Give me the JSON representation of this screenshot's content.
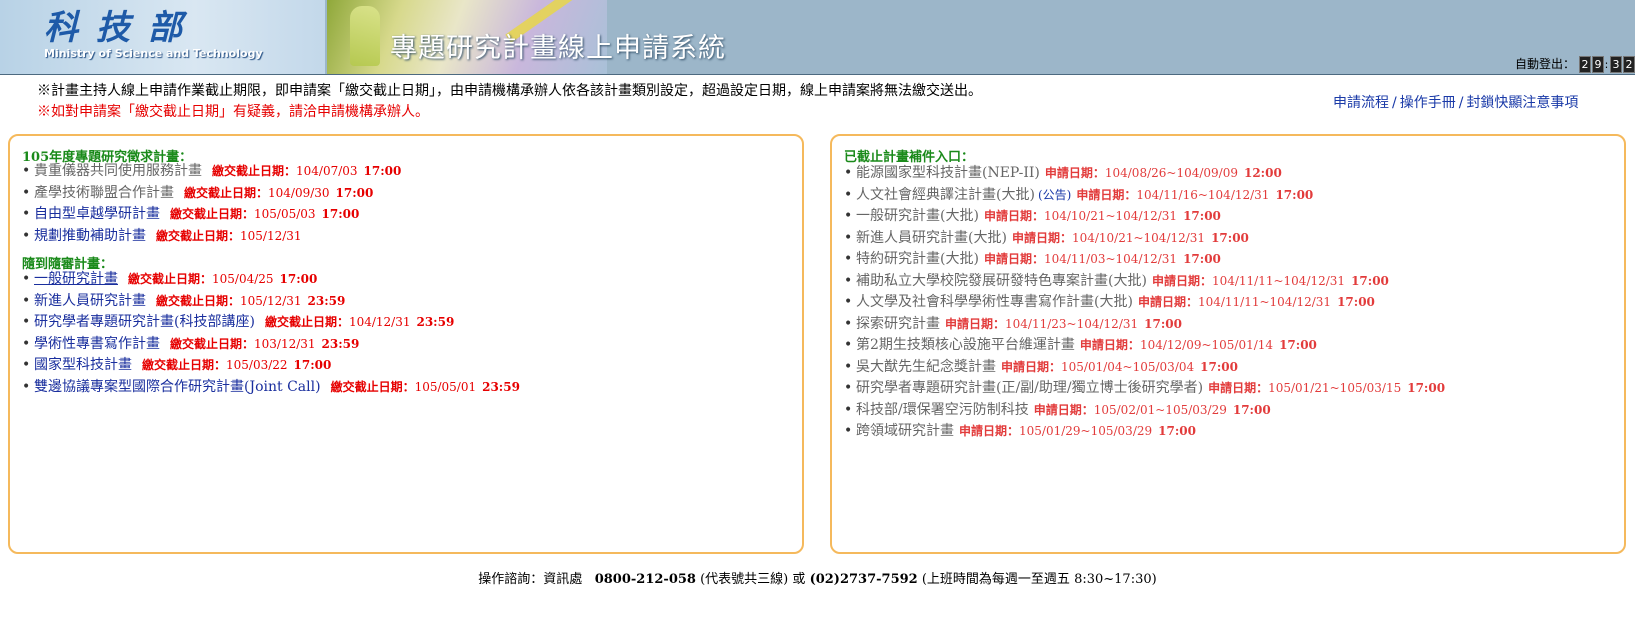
{
  "header": {
    "logo_mark": "科技部",
    "logo_en": "Ministry of Science and Technology",
    "system_title": "專題研究計畫線上申請系統",
    "logout_label": "自動登出：",
    "timer_digits": [
      "2",
      "9",
      "3",
      "2"
    ]
  },
  "notices": {
    "line1": "※計畫主持人線上申請作業截止期限，即申請案「繳交截止日期」，由申請機構承辦人依各該計畫類別設定，超過設定日期，線上申請案將無法繳交送出。",
    "line2": "※如對申請案「繳交截止日期」有疑義，請洽申請機構承辦人。"
  },
  "top_links": [
    "申請流程",
    "操作手冊",
    "封鎖快顯注意事項"
  ],
  "left_panel": {
    "section1_title": "105年度專題研究徵求計畫：",
    "deadline_label": "繳交截止日期：",
    "section1_items": [
      {
        "name": "貴重儀器共同使用服務計畫",
        "date": "104/07/03",
        "time": "17:00",
        "style": "gray"
      },
      {
        "name": "產學技術聯盟合作計畫",
        "date": "104/09/30",
        "time": "17:00",
        "style": "gray"
      },
      {
        "name": "自由型卓越學研計畫",
        "date": "105/05/03",
        "time": "17:00",
        "style": "blue"
      },
      {
        "name": "規劃推動補助計畫",
        "date": "105/12/31",
        "time": "",
        "style": "blue"
      }
    ],
    "section2_title": "隨到隨審計畫：",
    "section2_items": [
      {
        "name": "一般研究計畫",
        "date": "105/04/25",
        "time": "17:00",
        "style": "blue-ul"
      },
      {
        "name": "新進人員研究計畫",
        "date": "105/12/31",
        "time": "23:59",
        "style": "blue"
      },
      {
        "name": "研究學者專題研究計畫(科技部講座)",
        "date": "104/12/31",
        "time": "23:59",
        "style": "blue"
      },
      {
        "name": "學術性專書寫作計畫",
        "date": "103/12/31",
        "time": "23:59",
        "style": "blue"
      },
      {
        "name": "國家型科技計畫",
        "date": "105/03/22",
        "time": "17:00",
        "style": "blue"
      },
      {
        "name": "雙邊協議專案型國際合作研究計畫(Joint Call)",
        "date": "105/05/01",
        "time": "23:59",
        "style": "blue"
      }
    ]
  },
  "right_panel": {
    "section_title": "已截止計畫補件入口：",
    "apply_label": "申請日期：",
    "notice_link": "(公告)",
    "items": [
      {
        "name": "能源國家型科技計畫(NEP-II)",
        "range": "104/08/26~104/09/09",
        "time": "12:00"
      },
      {
        "name": "人文社會經典譯注計畫(大批)",
        "range": "104/11/16~104/12/31",
        "time": "17:00",
        "has_notice": true
      },
      {
        "name": "一般研究計畫(大批)",
        "range": "104/10/21~104/12/31",
        "time": "17:00"
      },
      {
        "name": "新進人員研究計畫(大批)",
        "range": "104/10/21~104/12/31",
        "time": "17:00"
      },
      {
        "name": "特約研究計畫(大批)",
        "range": "104/11/03~104/12/31",
        "time": "17:00"
      },
      {
        "name": "補助私立大學校院發展研發特色專案計畫(大批)",
        "range": "104/11/11~104/12/31",
        "time": "17:00"
      },
      {
        "name": "人文學及社會科學學術性專書寫作計畫(大批)",
        "range": "104/11/11~104/12/31",
        "time": "17:00"
      },
      {
        "name": "探索研究計畫",
        "range": "104/11/23~104/12/31",
        "time": "17:00"
      },
      {
        "name": "第2期生技類核心設施平台維運計畫",
        "range": "104/12/09~105/01/14",
        "time": "17:00"
      },
      {
        "name": "吳大猷先生紀念獎計畫",
        "range": "105/01/04~105/03/04",
        "time": "17:00"
      },
      {
        "name": "研究學者專題研究計畫(正/副/助理/獨立博士後研究學者)",
        "range": "105/01/21~105/03/15",
        "time": "17:00"
      },
      {
        "name": "科技部/環保署空污防制科技",
        "range": "105/02/01~105/03/29",
        "time": "17:00"
      },
      {
        "name": "跨領域研究計畫",
        "range": "105/01/29~105/03/29",
        "time": "17:00"
      }
    ]
  },
  "footer": {
    "label": "操作諮詢：資訊處",
    "phone1": "0800-212-058",
    "phone1_note": "(代表號共三線)",
    "or": "或",
    "phone2": "(02)2737-7592",
    "hours": "(上班時間為每週一至週五 8:30~17:30)"
  }
}
